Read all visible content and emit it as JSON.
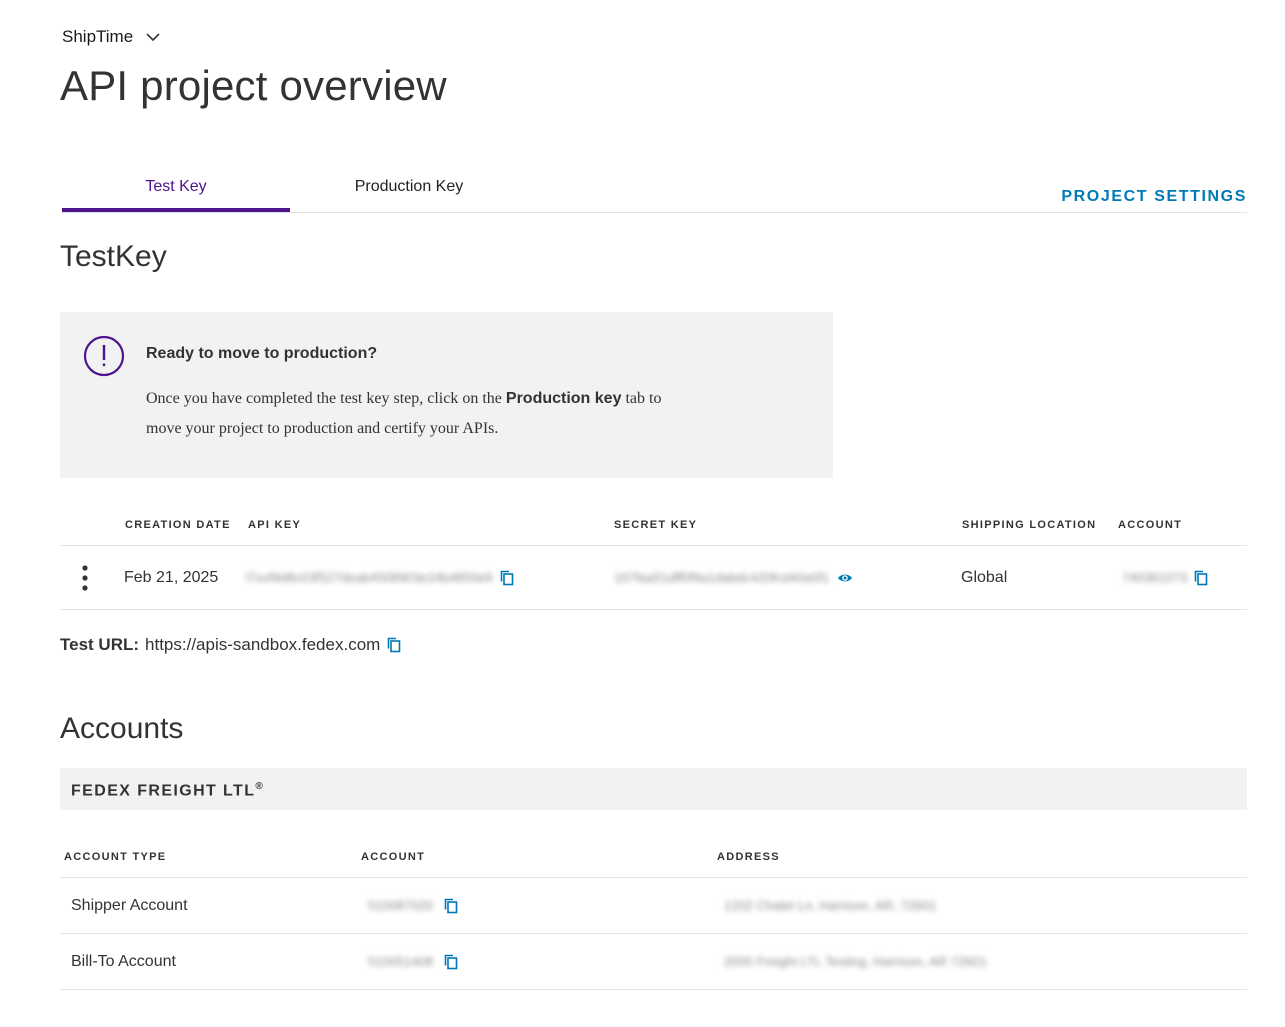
{
  "header": {
    "project_name": "ShipTime",
    "page_title": "API project overview"
  },
  "tabs": {
    "test": "Test Key",
    "production": "Production Key",
    "settings": "PROJECT SETTINGS"
  },
  "testkey": {
    "title": "TestKey",
    "notice": {
      "heading": "Ready to move to production?",
      "body_before": "Once you have completed the test key step, click on the ",
      "body_strong": "Production key",
      "body_after": " tab to move your project to production and certify your APIs."
    },
    "columns": {
      "creation_date": "CREATION DATE",
      "api_key": "API KEY",
      "secret_key": "SECRET KEY",
      "shipping_location": "SHIPPING LOCATION",
      "account": "ACCOUNT"
    },
    "row": {
      "creation_date": "Feb 21, 2025",
      "api_key": "l7xxf9d8c03f527deab4508903e24b4850e9",
      "secret_key": "167faa51dff0f9a1dabdc420fcd40a0f1",
      "shipping_location": "Global",
      "account": "740361073"
    },
    "test_url_label": "Test URL:",
    "test_url": "https://apis-sandbox.fedex.com"
  },
  "accounts": {
    "title": "Accounts",
    "group_name": "FEDEX FREIGHT LTL",
    "group_mark": "®",
    "columns": {
      "type": "ACCOUNT TYPE",
      "account": "ACCOUNT",
      "address": "ADDRESS"
    },
    "rows": [
      {
        "type": "Shipper Account",
        "account": "510087020",
        "address": "1202 Chalet Ln, Harrison, AR, 72601"
      },
      {
        "type": "Bill-To Account",
        "account": "510051408",
        "address": "2000 Freight LTL Testing, Harrison, AR 72601"
      }
    ]
  },
  "colors": {
    "accent_purple": "#4d148c",
    "link_blue": "#007ab7",
    "notice_bg": "#f2f2f2"
  }
}
